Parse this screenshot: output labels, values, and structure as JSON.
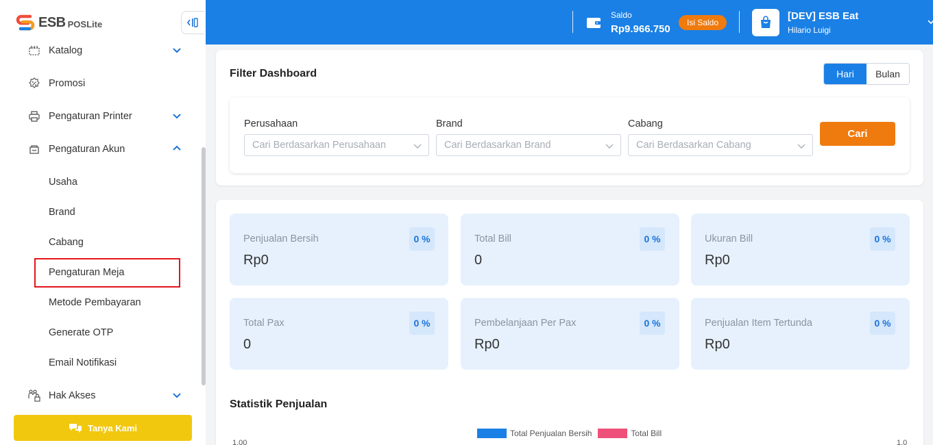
{
  "brand": {
    "name": "ESB",
    "sub": "POSLite"
  },
  "sidebar": {
    "items": [
      {
        "label": "Katalog",
        "icon": "catalog-icon",
        "expandable": true,
        "expanded": false
      },
      {
        "label": "Promosi",
        "icon": "discount-icon",
        "expandable": false
      },
      {
        "label": "Pengaturan Printer",
        "icon": "printer-icon",
        "expandable": true,
        "expanded": false
      },
      {
        "label": "Pengaturan Akun",
        "icon": "account-settings-icon",
        "expandable": true,
        "expanded": true
      },
      {
        "label": "Hak Akses",
        "icon": "access-rights-icon",
        "expandable": true,
        "expanded": false
      }
    ],
    "subitems": [
      "Usaha",
      "Brand",
      "Cabang",
      "Pengaturan Meja",
      "Metode Pembayaran",
      "Generate OTP",
      "Email Notifikasi"
    ],
    "help_label": "Tanya Kami"
  },
  "header": {
    "saldo_label": "Saldo",
    "saldo_value": "Rp9.966.750",
    "topup_label": "Isi Saldo",
    "store_name": "[DEV] ESB Eat",
    "user_name": "Hilario Luigi"
  },
  "filter": {
    "title": "Filter Dashboard",
    "period_options": [
      "Hari",
      "Bulan"
    ],
    "period_selected": "Hari",
    "fields": [
      {
        "label": "Perusahaan",
        "placeholder": "Cari Berdasarkan Perusahaan"
      },
      {
        "label": "Brand",
        "placeholder": "Cari Berdasarkan Brand"
      },
      {
        "label": "Cabang",
        "placeholder": "Cari Berdasarkan Cabang"
      }
    ],
    "search_label": "Cari"
  },
  "stats": [
    {
      "label": "Penjualan Bersih",
      "value": "Rp0",
      "pct": "0 %"
    },
    {
      "label": "Total Bill",
      "value": "0",
      "pct": "0 %"
    },
    {
      "label": "Ukuran Bill",
      "value": "Rp0",
      "pct": "0 %"
    },
    {
      "label": "Total Pax",
      "value": "0",
      "pct": "0 %"
    },
    {
      "label": "Pembelanjaan Per Pax",
      "value": "Rp0",
      "pct": "0 %"
    },
    {
      "label": "Penjualan Item Tertunda",
      "value": "Rp0",
      "pct": "0 %"
    }
  ],
  "sales_chart": {
    "title": "Statistik Penjualan",
    "legend": [
      {
        "name": "Total Penjualan Bersih",
        "color": "#1a80e5"
      },
      {
        "name": "Total Bill",
        "color": "#ef5079"
      }
    ],
    "y_left_top": "1.00",
    "y_right_top": "1.0"
  },
  "colors": {
    "primary": "#1a80e5",
    "accent": "#ef7a0e",
    "help": "#f2c80f",
    "highlight": "#e3141b"
  }
}
